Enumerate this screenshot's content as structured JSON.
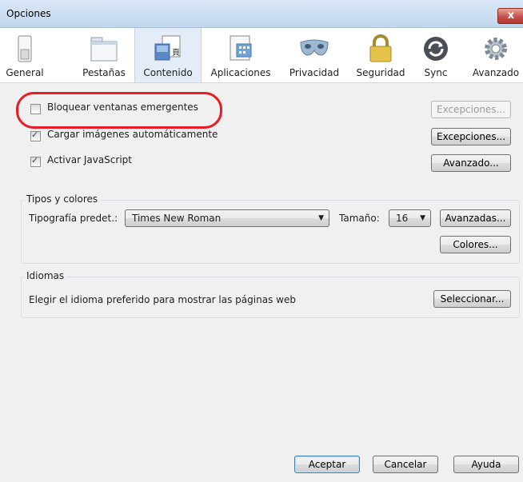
{
  "window": {
    "title": "Opciones",
    "close_glyph": "x"
  },
  "tabs": [
    {
      "label": "General",
      "icon": "switch-icon"
    },
    {
      "label": "Pestañas",
      "icon": "tabs-icon"
    },
    {
      "label": "Contenido",
      "icon": "content-icon"
    },
    {
      "label": "Aplicaciones",
      "icon": "applications-icon"
    },
    {
      "label": "Privacidad",
      "icon": "mask-icon"
    },
    {
      "label": "Seguridad",
      "icon": "lock-icon"
    },
    {
      "label": "Sync",
      "icon": "sync-icon"
    },
    {
      "label": "Avanzado",
      "icon": "gear-icon"
    }
  ],
  "selected_tab": "Contenido",
  "content": {
    "popup_label": "Bloquear ventanas emergentes",
    "popup_checked": false,
    "popup_exceptions": "Excepciones...",
    "images_label": "Cargar imágenes automáticamente",
    "images_checked": true,
    "images_exceptions": "Excepciones...",
    "js_label": "Activar JavaScript",
    "js_checked": true,
    "js_advanced": "Avanzado..."
  },
  "fonts": {
    "group_title": "Tipos y colores",
    "default_font_label": "Tipografía predet.:",
    "font_value": "Times New Roman",
    "size_label": "Tamaño:",
    "size_value": "16",
    "advanced_button": "Avanzadas...",
    "colors_button": "Colores..."
  },
  "languages": {
    "group_title": "Idiomas",
    "description": "Elegir el idioma preferido para mostrar las páginas web",
    "select_button": "Seleccionar..."
  },
  "footer": {
    "ok": "Aceptar",
    "cancel": "Cancelar",
    "help": "Ayuda"
  },
  "colors": {
    "highlight": "#e81c23",
    "titlebar": "#c2d7ee",
    "selected_tab": "#e4ecf7"
  }
}
